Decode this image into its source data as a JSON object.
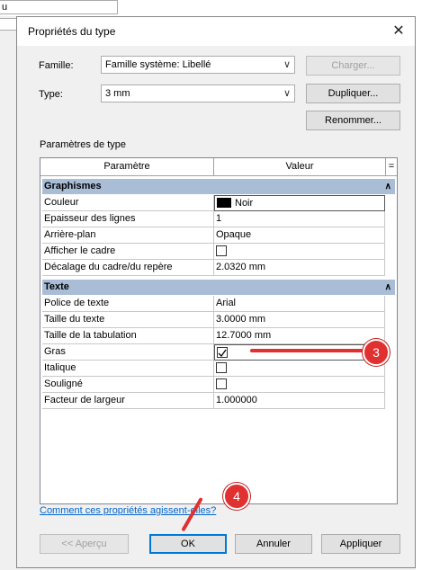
{
  "background": {
    "cell_text": "u"
  },
  "dialog": {
    "title": "Propriétés du type",
    "close_glyph": "✕",
    "famille_label": "Famille:",
    "famille_value": "Famille système: Libellé",
    "type_label": "Type:",
    "type_value": "3 mm",
    "charger_label": "Charger...",
    "dupliquer_label": "Dupliquer...",
    "renommer_label": "Renommer...",
    "params_title": "Paramètres de type",
    "grid": {
      "col_param": "Paramètre",
      "col_value": "Valeur",
      "col_eq": "=",
      "groups": [
        {
          "name": "Graphismes",
          "rows": [
            {
              "param": "Couleur",
              "value": "Noir"
            },
            {
              "param": "Epaisseur des lignes",
              "value": "1"
            },
            {
              "param": "Arrière-plan",
              "value": "Opaque"
            },
            {
              "param": "Afficher le cadre",
              "value": ""
            },
            {
              "param": "Décalage du cadre/du repère",
              "value": "2.0320 mm"
            }
          ]
        },
        {
          "name": "Texte",
          "rows": [
            {
              "param": "Police de texte",
              "value": "Arial"
            },
            {
              "param": "Taille du texte",
              "value": "3.0000 mm"
            },
            {
              "param": "Taille de la tabulation",
              "value": "12.7000 mm"
            },
            {
              "param": "Gras",
              "value": ""
            },
            {
              "param": "Italique",
              "value": ""
            },
            {
              "param": "Souligné",
              "value": ""
            },
            {
              "param": "Facteur de largeur",
              "value": "1.000000"
            }
          ]
        }
      ]
    },
    "help_link": "Comment ces propriétés agissent-elles?",
    "apercu_label": "<< Aperçu",
    "ok_label": "OK",
    "annuler_label": "Annuler",
    "appliquer_label": "Appliquer"
  },
  "annotations": {
    "badge3": "3",
    "badge4": "4",
    "accent": "#e03030"
  }
}
